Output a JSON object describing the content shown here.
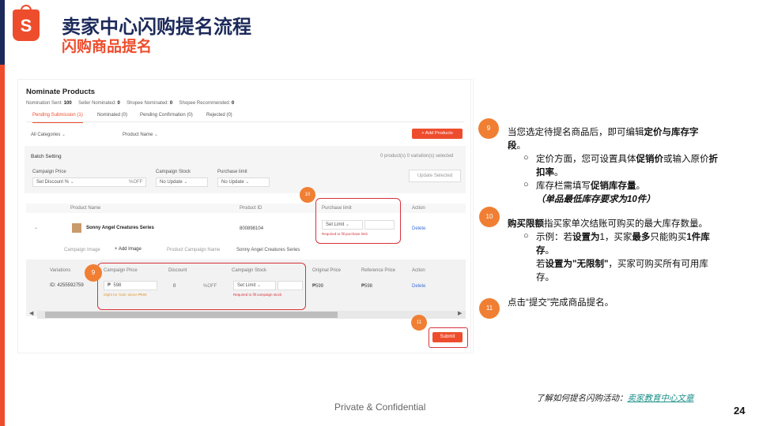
{
  "header": {
    "logo_letter": "S",
    "title": "卖家中心闪购提名流程",
    "subtitle": "闪购商品提名"
  },
  "panel": {
    "title": "Nominate Products",
    "counts": [
      {
        "label": "Nomination Sent:",
        "value": "100"
      },
      {
        "label": "Seller Nominated:",
        "value": "0"
      },
      {
        "label": "Shopee Nominated:",
        "value": "0"
      },
      {
        "label": "Shopee Recommended:",
        "value": "0"
      }
    ],
    "tabs": [
      "Pending Submission (1)",
      "Nominated (0)",
      "Pending Confirmation (0)",
      "Rejected (0)"
    ],
    "category_filter": "All Categories",
    "name_filter": "Product Name",
    "add_products": "+ Add Products",
    "batch": {
      "title": "Batch Setting",
      "selected": "0 product(s) 0 variation(s) selected",
      "campaign_price_label": "Campaign Price",
      "campaign_price_value": "Set Discount %",
      "campaign_price_suffix": "%OFF",
      "campaign_stock_label": "Campaign Stock",
      "campaign_stock_value": "No Update",
      "purchase_limit_label": "Purchase limit",
      "purchase_limit_value": "No Update",
      "update_selected": "Update Selected"
    },
    "columns": [
      "Product Name",
      "Product ID",
      "Purchase limit",
      "Action"
    ],
    "row": {
      "name": "Sonny Angel Creatures Series",
      "id": "800898104",
      "limit_select": "Set Limit",
      "limit_error": "Required to fill purchase limit",
      "action": "Delete",
      "campaign_image": "Campaign Image",
      "add_image": "+ Add Image",
      "campaign_name_label": "Product Campaign Name",
      "campaign_name": "Sonny Angel Creatures Series"
    },
    "sub_columns": [
      "Variations",
      "Campaign Price",
      "Discount",
      "Campaign Stock",
      "Original Price",
      "Reference Price",
      "Action"
    ],
    "sub_row": {
      "variation": "ID: 4255592759",
      "currency": "₱",
      "price": "598",
      "discount": "0",
      "discount_suffix": "%OFF",
      "price_hint": "Might be 'Sale' above ₱598",
      "stock_select": "Set Limit",
      "stock_error": "Required to fill campaign stock",
      "original_price": "₱599",
      "reference_price": "₱598",
      "action": "Delete"
    },
    "submit": "Submit",
    "badges": {
      "campaign_price": "9",
      "purchase_limit": "10",
      "submit": "11"
    }
  },
  "instructions": {
    "items": [
      {
        "badge": "9",
        "text_pre": "当您选定待提名商品后，即可编辑",
        "text_bold": "定价与库存字段",
        "text_post": "。"
      },
      {
        "badge": "10",
        "text_bold": "购买限额",
        "text_post": "指买家单次结账可购买的最大库存数量。"
      },
      {
        "badge": "11",
        "text_pre": "点击“提交”完成商品提名。"
      }
    ],
    "sub_a1_pre": "定价方面，您可设置具体",
    "sub_a1_b1": "促销价",
    "sub_a1_mid": "或输入原价",
    "sub_a1_b2": "折扣率",
    "sub_a1_post": "。",
    "sub_a2_pre": "库存栏需填写",
    "sub_a2_b": "促销库存量",
    "sub_a2_post": "。",
    "sub_a3": "（单品最低库存要求为10件）",
    "sub_b1_pre": "示例：若",
    "sub_b1_b1": "设置为",
    "sub_b1_v1": "1，买家",
    "sub_b1_b2": "最多",
    "sub_b1_mid": "只能购买",
    "sub_b1_b3": "1件库存",
    "sub_b1_post": "。",
    "sub_b2_pre": "若",
    "sub_b2_b": "设置为\"无限制\"",
    "sub_b2_post": "，买家可购买所有可用库存。"
  },
  "footer": {
    "note_pre": "了解如何提名闪购活动：",
    "note_link": "卖家教育中心文章",
    "center": "Private & Confidential",
    "page": "24"
  }
}
